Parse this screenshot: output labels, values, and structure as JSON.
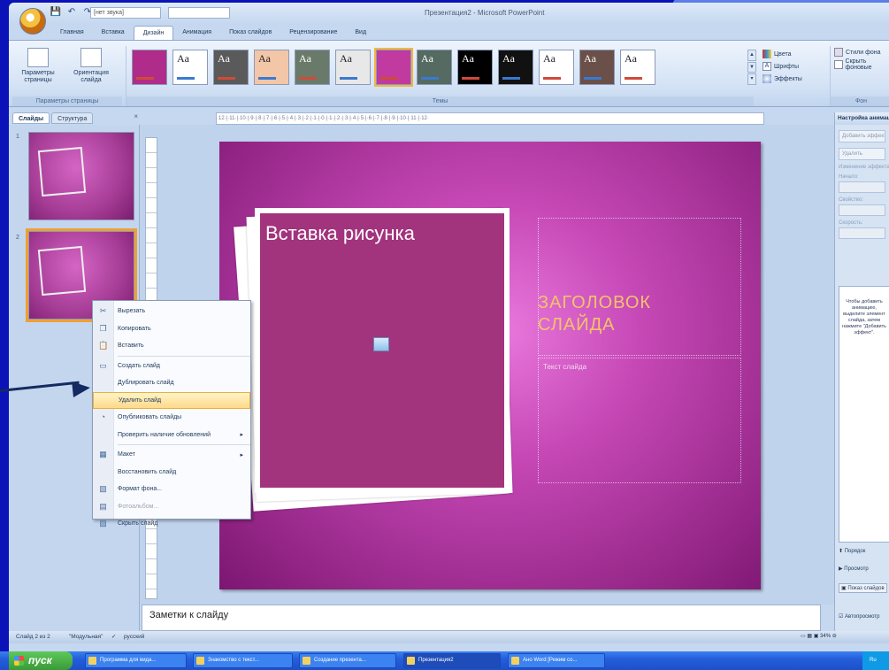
{
  "window": {
    "title": "Презентация2 - Microsoft PowerPoint",
    "qat_combo": "[нет звука]"
  },
  "tabs": [
    "Главная",
    "Вставка",
    "Дизайн",
    "Анимация",
    "Показ слайдов",
    "Рецензирование",
    "Вид"
  ],
  "ribbon": {
    "page_setup_label": "Параметры страницы",
    "orientation_label": "Ориентация слайда",
    "group_page": "Параметры страницы",
    "group_themes": "Темы",
    "group_background": "Фон",
    "theme_thumb_text": "Aa",
    "colors_label": "Цвета",
    "fonts_label": "Шрифты",
    "effects_label": "Эффекты",
    "bg_styles_label": "Стили фона",
    "hide_bg_label": "Скрыть фоновые"
  },
  "theme_colors": [
    "#b02c8a",
    "#ffffff",
    "#5a5a5a",
    "#f3c6a8",
    "#6a7a6a",
    "#e8e8e8",
    "#c03aa0",
    "#556a60",
    "#000000",
    "#111111",
    "#ffffff",
    "#6a5048",
    "#ffffff"
  ],
  "left_pane": {
    "tab_slides": "Слайды",
    "tab_outline": "Структура",
    "close": "×",
    "slide_numbers": [
      "1",
      "2"
    ]
  },
  "ruler_text": "·12·|·11·|·10·|·9·|·8·|·7·|·6·|·5·|·4·|·3·|·2·|·1·|·0·|·1·|·2·|·3·|·4·|·5·|·6·|·7·|·8·|·9·|·10·|·11·|·12·",
  "slide": {
    "picture_title": "Вставка рисунка",
    "title_line1": "ЗАГОЛОВОК",
    "title_line2": "СЛАЙДА",
    "body_text": "Текст слайда"
  },
  "context_menu": {
    "items": [
      {
        "label": "Вырезать",
        "icon": "scissors-icon",
        "glyph": "✂"
      },
      {
        "label": "Копировать",
        "icon": "copy-icon",
        "glyph": "❐"
      },
      {
        "label": "Вставить",
        "icon": "paste-icon",
        "glyph": "📋"
      },
      {
        "label": "Создать слайд",
        "icon": "new-slide-icon",
        "glyph": "▭"
      },
      {
        "label": "Дублировать слайд",
        "icon": "",
        "glyph": ""
      },
      {
        "label": "Удалить слайд",
        "icon": "",
        "glyph": ""
      },
      {
        "label": "Опубликовать слайды",
        "icon": "publish-icon",
        "glyph": "◔"
      },
      {
        "label": "Проверить наличие обновлений",
        "icon": "",
        "glyph": ""
      },
      {
        "label": "Макет",
        "icon": "layout-icon",
        "glyph": "▦"
      },
      {
        "label": "Восстановить слайд",
        "icon": "",
        "glyph": ""
      },
      {
        "label": "Формат фона...",
        "icon": "format-bg-icon",
        "glyph": "▧"
      },
      {
        "label": "Фотоальбом...",
        "icon": "photo-album-icon",
        "glyph": "▤"
      },
      {
        "label": "Скрыть слайд",
        "icon": "hide-slide-icon",
        "glyph": "▨"
      }
    ],
    "submenu_arrow": "▸"
  },
  "task_pane": {
    "title": "Настройка анимации",
    "add_effect": "Добавить эффект",
    "remove": "Удалить",
    "change_link": "Изменение эффекта",
    "start_label": "Начало:",
    "property_label": "Свойство:",
    "speed_label": "Скорость:",
    "hint": "Чтобы добавить анимацию, выделите элемент слайда, затем нажмите \"Добавить эффект\".",
    "reorder": "Порядок",
    "play": "Просмотр",
    "slideshow": "Показ слайдов",
    "autopreview": "Автопросмотр"
  },
  "notes": {
    "text": "Заметки к слайду"
  },
  "status": {
    "slide_counter": "Слайд 2 из 2",
    "theme_name": "\"Модульная\"",
    "language": "русский",
    "zoom": "34%"
  },
  "taskbar": {
    "start": "пуск",
    "items": [
      "Программа для вида...",
      "Знакомство с текст...",
      "Создание презента...",
      "Презентация2",
      "Ано Word [Режим со..."
    ],
    "tray": "Ru"
  }
}
